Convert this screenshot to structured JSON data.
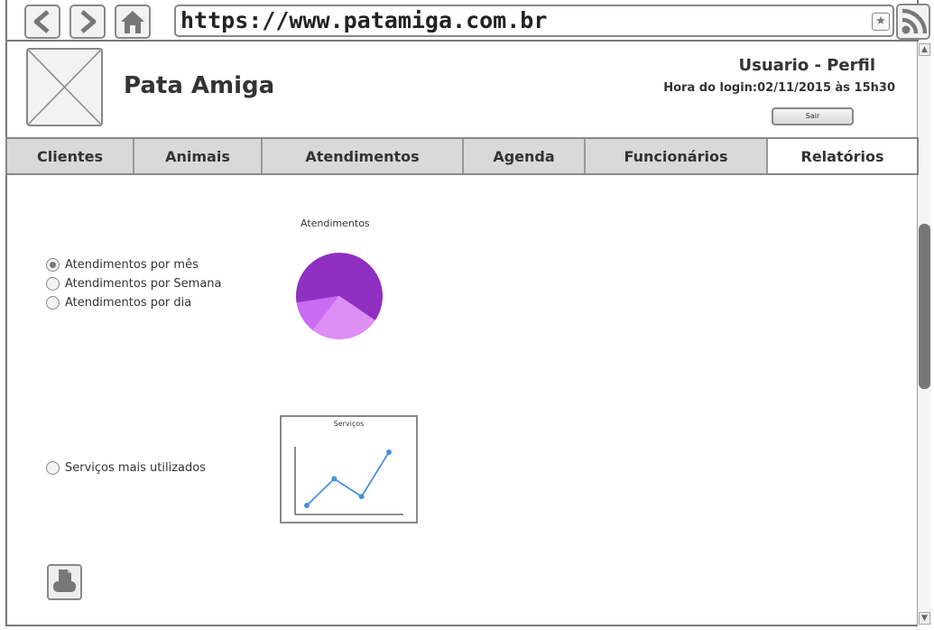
{
  "browser": {
    "url": "https://www.patamiga.com.br",
    "back_icon": "chevron-left-icon",
    "forward_icon": "chevron-right-icon",
    "home_icon": "home-icon",
    "bookmark_icon": "star-icon",
    "rss_icon": "rss-icon"
  },
  "header": {
    "app_title": "Pata Amiga",
    "user_label": "Usuario - Perfil",
    "login_time": "Hora do login:02/11/2015 às 15h30",
    "logout_label": "Sair"
  },
  "tabs": [
    {
      "label": "Clientes",
      "active": false
    },
    {
      "label": "Animais",
      "active": false
    },
    {
      "label": "Atendimentos",
      "active": false
    },
    {
      "label": "Agenda",
      "active": false
    },
    {
      "label": "Funcionários",
      "active": false
    },
    {
      "label": "Relatórios",
      "active": true
    }
  ],
  "report_options": [
    {
      "label": "Atendimentos por mês",
      "selected": true
    },
    {
      "label": "Atendimentos por Semana",
      "selected": false
    },
    {
      "label": "Atendimentos por dia",
      "selected": false
    }
  ],
  "services_option": {
    "label": "Serviços mais utilizados",
    "selected": false
  },
  "chart_data": [
    {
      "type": "pie",
      "title": "Atendimentos",
      "values": [
        62,
        26,
        12
      ],
      "colors": [
        "#8f2fc2",
        "#dd8ef5",
        "#c96cf4"
      ]
    },
    {
      "type": "line",
      "title": "Serviços",
      "x": [
        1,
        2,
        3,
        4
      ],
      "values": [
        1,
        4,
        2,
        7
      ],
      "color": "#4a90d9"
    }
  ],
  "print_icon": "printer-icon"
}
